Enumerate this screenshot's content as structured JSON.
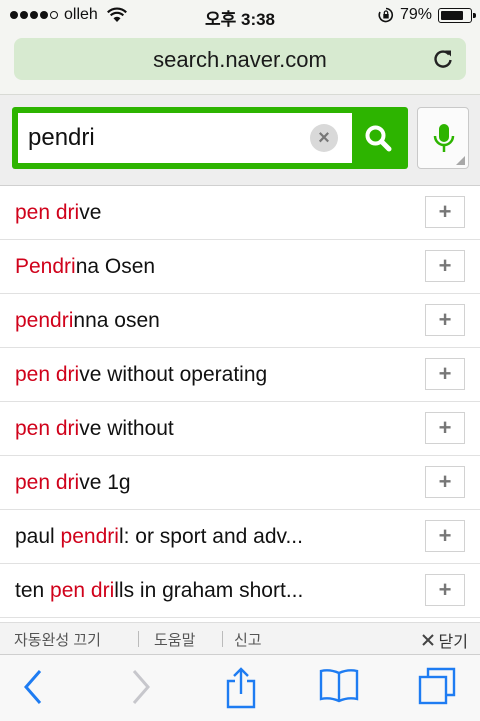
{
  "status": {
    "carrier": "olleh",
    "time": "오후 3:38",
    "battery": "79%",
    "battery_level": 0.79
  },
  "browser": {
    "url": "search.naver.com"
  },
  "search": {
    "query": "pendri"
  },
  "suggestions": [
    {
      "parts": [
        {
          "t": "pen dri",
          "hl": true
        },
        {
          "t": "ve",
          "hl": false
        }
      ]
    },
    {
      "parts": [
        {
          "t": "Pendri",
          "hl": true
        },
        {
          "t": "na Osen",
          "hl": false
        }
      ]
    },
    {
      "parts": [
        {
          "t": "pendri",
          "hl": true
        },
        {
          "t": "nna osen",
          "hl": false
        }
      ]
    },
    {
      "parts": [
        {
          "t": "pen dri",
          "hl": true
        },
        {
          "t": "ve without operating",
          "hl": false
        }
      ]
    },
    {
      "parts": [
        {
          "t": "pen dri",
          "hl": true
        },
        {
          "t": "ve without",
          "hl": false
        }
      ]
    },
    {
      "parts": [
        {
          "t": "pen dri",
          "hl": true
        },
        {
          "t": "ve 1g",
          "hl": false
        }
      ]
    },
    {
      "parts": [
        {
          "t": "paul ",
          "hl": false
        },
        {
          "t": "pendri",
          "hl": true
        },
        {
          "t": "l: or sport and adv...",
          "hl": false
        }
      ]
    },
    {
      "parts": [
        {
          "t": "ten ",
          "hl": false
        },
        {
          "t": "pen dri",
          "hl": true
        },
        {
          "t": "lls in graham short...",
          "hl": false
        }
      ]
    }
  ],
  "suggestion_add_label": "+",
  "footer": {
    "autocomplete_off": "자동완성 끄기",
    "help": "도움말",
    "report": "신고",
    "close": "닫기"
  },
  "colors": {
    "brand_green": "#2db400",
    "highlight_red": "#d0021b",
    "ios_blue": "#1e7cf2"
  },
  "icons": {
    "status": [
      "signal-dots-icon",
      "wifi-icon",
      "rotation-lock-icon",
      "battery-icon"
    ],
    "toolbar": [
      "back-icon",
      "forward-icon",
      "share-icon",
      "bookmarks-icon",
      "tabs-icon"
    ]
  }
}
